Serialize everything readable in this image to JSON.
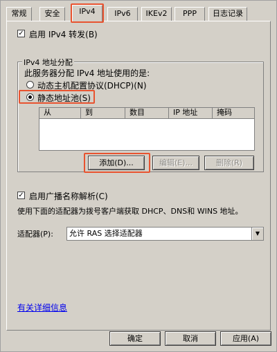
{
  "tabs": [
    {
      "label": "常规"
    },
    {
      "label": "安全"
    },
    {
      "label": "IPv4"
    },
    {
      "label": "IPv6"
    },
    {
      "label": "IKEv2"
    },
    {
      "label": "PPP"
    },
    {
      "label": "日志记录"
    }
  ],
  "active_tab": "IPv4",
  "ipv4_forwarding": {
    "label": "启用 IPv4 转发(B)",
    "checked": true
  },
  "address_group": {
    "title": "IPv4 地址分配",
    "description": "此服务器分配 IPv4 地址使用的是:",
    "dhcp_option": {
      "label": "动态主机配置协议(DHCP)(N)",
      "selected": false
    },
    "static_option": {
      "label": "静态地址池(S)",
      "selected": true
    },
    "columns": [
      "从",
      "到",
      "数目",
      "IP 地址",
      "掩码"
    ],
    "buttons": {
      "add": "添加(D)...",
      "edit": "编辑(E)...",
      "delete": "删除(R)"
    }
  },
  "broadcast": {
    "label": "启用广播名称解析(C)",
    "checked": true
  },
  "adapter_description": "使用下面的适配器为拨号客户端获取 DHCP、DNS和 WINS 地址。",
  "adapter": {
    "label": "适配器(P):",
    "value": "允许 RAS 选择适配器"
  },
  "more_info_link": "有关详细信息",
  "footer": {
    "ok": "确定",
    "cancel": "取消",
    "apply": "应用(A)"
  },
  "colors": {
    "highlight": "#e8532f",
    "dialog_bg": "#d4d0c8",
    "link": "#0000ee"
  }
}
